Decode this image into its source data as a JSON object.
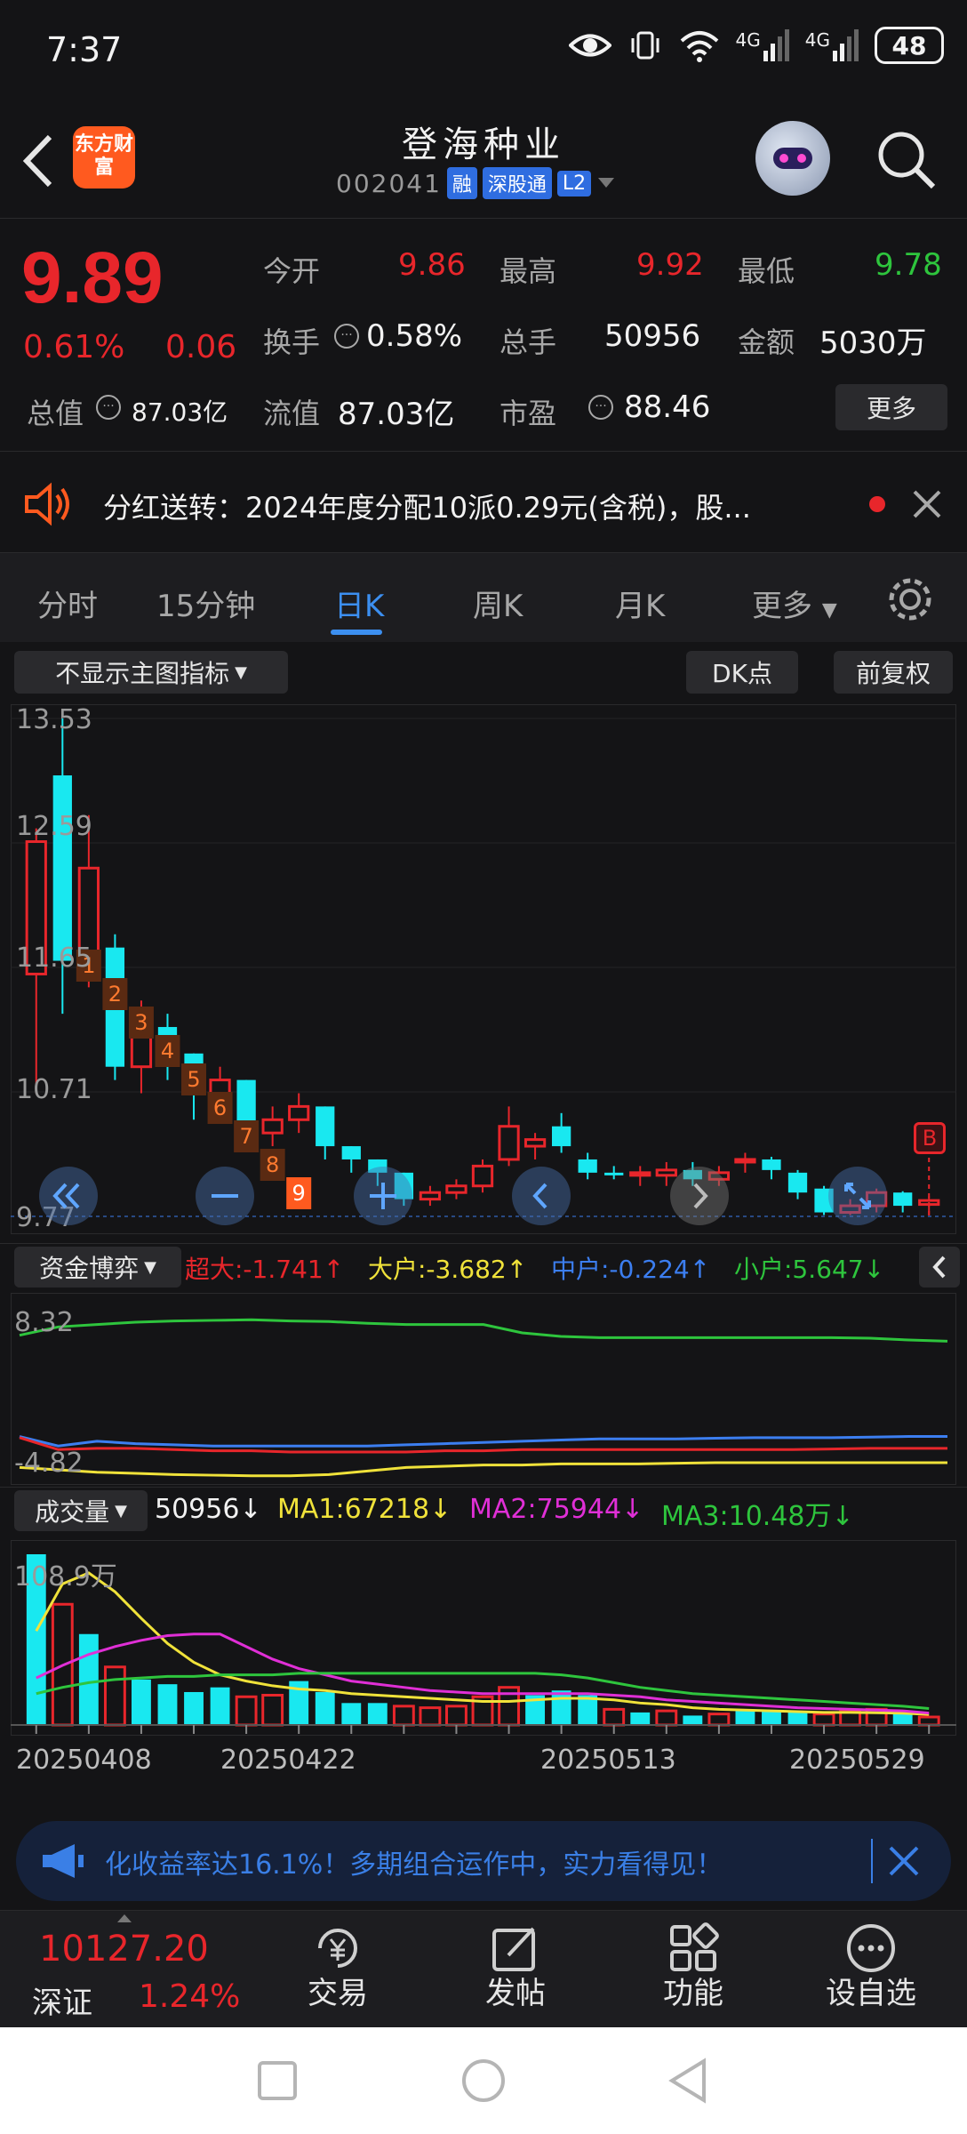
{
  "status_bar": {
    "time": "7:37",
    "battery": "48",
    "network1": "4G",
    "network2": "4G"
  },
  "header": {
    "stock_name": "登海种业",
    "stock_code": "002041",
    "tags": [
      "融",
      "深股通",
      "L2"
    ],
    "brand": "东方财富"
  },
  "quote": {
    "price": "9.89",
    "change_pct": "0.61%",
    "change": "0.06",
    "open_label": "今开",
    "open": "9.86",
    "high_label": "最高",
    "high": "9.92",
    "low_label": "最低",
    "low": "9.78",
    "turnover_label": "换手",
    "turnover": "0.58%",
    "volume_label": "总手",
    "volume": "50956",
    "amount_label": "金额",
    "amount": "5030万",
    "mktcap_label": "总值",
    "mktcap": "87.03亿",
    "float_label": "流值",
    "float_value": "87.03亿",
    "pe_label": "市盈",
    "pe": "88.46",
    "more_label": "更多"
  },
  "notice": {
    "text": "分红送转：2024年度分配10派0.29元(含税)，股..."
  },
  "tabs": [
    {
      "label": "分时"
    },
    {
      "label": "15分钟"
    },
    {
      "label": "日K"
    },
    {
      "label": "周K"
    },
    {
      "label": "月K"
    },
    {
      "label": "更多"
    }
  ],
  "chart_toolbar": {
    "indicator_select": "不显示主图指标",
    "dk_label": "DK点",
    "adjust_label": "前复权"
  },
  "kline": {
    "y_labels": [
      "13.53",
      "12.59",
      "11.65",
      "10.71",
      "9.77"
    ],
    "b_marker": "B",
    "counts": [
      "1",
      "2",
      "3",
      "4",
      "5",
      "6",
      "7",
      "8",
      "9"
    ]
  },
  "fund_flow": {
    "selector": "资金博弈",
    "super_large": "超大:-1.741↑",
    "large": "大户:-3.682↑",
    "medium": "中户:-0.224↑",
    "small": "小户:5.647↓",
    "y_top": "8.32",
    "y_bottom": "-4.82"
  },
  "volume": {
    "selector": "成交量",
    "value": "50956↓",
    "ma1": "MA1:67218↓",
    "ma2": "MA2:75944↓",
    "ma3": "MA3:10.48万↓",
    "y_top": "108.9万",
    "dates": [
      "20250408",
      "20250422",
      "20250513",
      "20250529"
    ]
  },
  "ad_banner": {
    "text": "化收益率达16.1%！多期组合运作中，实力看得见！"
  },
  "bottom_nav": {
    "index_value": "10127.20",
    "index_name": "深证",
    "index_pct": "1.24%",
    "items": [
      {
        "label": "交易"
      },
      {
        "label": "发帖"
      },
      {
        "label": "功能"
      },
      {
        "label": "设自选"
      }
    ]
  },
  "chart_data": [
    {
      "type": "candlestick",
      "title": "",
      "ylim": [
        9.77,
        13.53
      ],
      "candles": [
        {
          "o": 12.6,
          "c": 11.6,
          "h": 12.7,
          "l": 10.7,
          "dir": "up"
        },
        {
          "o": 13.1,
          "c": 11.7,
          "h": 13.53,
          "l": 11.3,
          "dir": "down"
        },
        {
          "o": 11.6,
          "c": 12.4,
          "h": 12.8,
          "l": 11.5,
          "dir": "up"
        },
        {
          "o": 11.8,
          "c": 10.9,
          "h": 11.9,
          "l": 10.8,
          "dir": "down"
        },
        {
          "o": 10.9,
          "c": 11.3,
          "h": 11.4,
          "l": 10.7,
          "dir": "up"
        },
        {
          "o": 11.2,
          "c": 10.9,
          "h": 11.3,
          "l": 10.8,
          "dir": "down"
        },
        {
          "o": 11.0,
          "c": 10.7,
          "h": 11.0,
          "l": 10.5,
          "dir": "down"
        },
        {
          "o": 10.7,
          "c": 10.8,
          "h": 10.9,
          "l": 10.6,
          "dir": "up"
        },
        {
          "o": 10.8,
          "c": 10.4,
          "h": 10.8,
          "l": 10.3,
          "dir": "down"
        },
        {
          "o": 10.4,
          "c": 10.5,
          "h": 10.6,
          "l": 10.3,
          "dir": "up"
        },
        {
          "o": 10.5,
          "c": 10.6,
          "h": 10.7,
          "l": 10.4,
          "dir": "up"
        },
        {
          "o": 10.6,
          "c": 10.3,
          "h": 10.6,
          "l": 10.2,
          "dir": "down"
        },
        {
          "o": 10.3,
          "c": 10.2,
          "h": 10.3,
          "l": 10.1,
          "dir": "down"
        },
        {
          "o": 10.2,
          "c": 10.1,
          "h": 10.2,
          "l": 10.0,
          "dir": "down"
        },
        {
          "o": 10.1,
          "c": 9.9,
          "h": 10.1,
          "l": 9.85,
          "dir": "down"
        },
        {
          "o": 9.9,
          "c": 9.95,
          "h": 10.0,
          "l": 9.85,
          "dir": "up"
        },
        {
          "o": 9.95,
          "c": 10.0,
          "h": 10.05,
          "l": 9.9,
          "dir": "up"
        },
        {
          "o": 10.0,
          "c": 10.15,
          "h": 10.2,
          "l": 9.95,
          "dir": "up"
        },
        {
          "o": 10.2,
          "c": 10.45,
          "h": 10.6,
          "l": 10.15,
          "dir": "up"
        },
        {
          "o": 10.3,
          "c": 10.35,
          "h": 10.4,
          "l": 10.2,
          "dir": "up"
        },
        {
          "o": 10.45,
          "c": 10.3,
          "h": 10.55,
          "l": 10.25,
          "dir": "down"
        },
        {
          "o": 10.2,
          "c": 10.1,
          "h": 10.25,
          "l": 10.05,
          "dir": "down"
        },
        {
          "o": 10.1,
          "c": 10.08,
          "h": 10.15,
          "l": 10.05,
          "dir": "down"
        },
        {
          "o": 10.08,
          "c": 10.1,
          "h": 10.15,
          "l": 10.0,
          "dir": "up"
        },
        {
          "o": 10.08,
          "c": 10.12,
          "h": 10.18,
          "l": 10.0,
          "dir": "up"
        },
        {
          "o": 10.12,
          "c": 10.05,
          "h": 10.18,
          "l": 10.0,
          "dir": "down"
        },
        {
          "o": 10.05,
          "c": 10.1,
          "h": 10.15,
          "l": 10.0,
          "dir": "up"
        },
        {
          "o": 10.18,
          "c": 10.2,
          "h": 10.25,
          "l": 10.1,
          "dir": "up"
        },
        {
          "o": 10.2,
          "c": 10.12,
          "h": 10.22,
          "l": 10.05,
          "dir": "down"
        },
        {
          "o": 10.1,
          "c": 9.95,
          "h": 10.12,
          "l": 9.9,
          "dir": "down"
        },
        {
          "o": 9.98,
          "c": 9.8,
          "h": 10.0,
          "l": 9.78,
          "dir": "down"
        },
        {
          "o": 9.8,
          "c": 9.85,
          "h": 9.9,
          "l": 9.78,
          "dir": "up"
        },
        {
          "o": 9.85,
          "c": 9.95,
          "h": 9.98,
          "l": 9.8,
          "dir": "up"
        },
        {
          "o": 9.95,
          "c": 9.85,
          "h": 9.96,
          "l": 9.8,
          "dir": "down"
        },
        {
          "o": 9.86,
          "c": 9.89,
          "h": 9.92,
          "l": 9.78,
          "dir": "up"
        }
      ]
    },
    {
      "type": "line",
      "title": "",
      "ylim": [
        -4.82,
        8.32
      ],
      "series": [
        {
          "color": "#2ec53d",
          "values": [
            7.0,
            7.7,
            7.9,
            8.1,
            8.2,
            8.25,
            8.3,
            8.2,
            8.15,
            8.0,
            7.9,
            7.9,
            7.9,
            7.2,
            6.9,
            6.8,
            6.8,
            6.8,
            6.8,
            6.8,
            6.8,
            6.8,
            6.75,
            6.6,
            6.5
          ]
        },
        {
          "color": "#3c7ef0",
          "values": [
            -1.5,
            -2.3,
            -1.9,
            -2.1,
            -2.2,
            -2.3,
            -2.3,
            -2.3,
            -2.3,
            -2.3,
            -2.2,
            -2.1,
            -2.0,
            -1.9,
            -1.8,
            -1.7,
            -1.7,
            -1.7,
            -1.65,
            -1.6,
            -1.6,
            -1.6,
            -1.55,
            -1.5,
            -1.5
          ]
        },
        {
          "color": "#e8262b",
          "values": [
            -1.6,
            -2.6,
            -2.5,
            -2.5,
            -2.6,
            -2.7,
            -2.7,
            -2.8,
            -2.8,
            -2.8,
            -2.8,
            -2.7,
            -2.7,
            -2.6,
            -2.6,
            -2.6,
            -2.6,
            -2.6,
            -2.6,
            -2.6,
            -2.6,
            -2.55,
            -2.5,
            -2.5,
            -2.5
          ]
        },
        {
          "color": "#f0e23a",
          "values": [
            -4.1,
            -4.3,
            -4.5,
            -4.6,
            -4.7,
            -4.75,
            -4.8,
            -4.8,
            -4.7,
            -4.4,
            -4.1,
            -4.0,
            -3.9,
            -3.9,
            -3.8,
            -3.8,
            -3.8,
            -3.75,
            -3.7,
            -3.7,
            -3.7,
            -3.7,
            -3.7,
            -3.7,
            -3.7
          ]
        }
      ]
    },
    {
      "type": "bar",
      "title": "",
      "ylim": [
        0,
        108.9
      ],
      "values": [
        108.9,
        77,
        58,
        37,
        29,
        26,
        21,
        24,
        18,
        19,
        28,
        21,
        14,
        14,
        12,
        11,
        12,
        18,
        24,
        19,
        22,
        19,
        10,
        8,
        9,
        6,
        7,
        10,
        9,
        8,
        7,
        9,
        10,
        8,
        5.1
      ],
      "dirs": [
        "down",
        "up",
        "down",
        "up",
        "down",
        "down",
        "down",
        "down",
        "up",
        "up",
        "down",
        "down",
        "down",
        "down",
        "up",
        "up",
        "up",
        "up",
        "up",
        "down",
        "down",
        "down",
        "up",
        "down",
        "up",
        "down",
        "up",
        "down",
        "down",
        "down",
        "up",
        "up",
        "up",
        "down",
        "up"
      ],
      "ma_series": [
        {
          "name": "MA1",
          "color": "#f0e23a",
          "values": [
            60,
            90,
            97,
            85,
            68,
            52,
            40,
            32,
            28,
            25,
            23,
            22,
            20,
            19,
            18,
            17,
            16,
            15,
            15,
            16,
            17,
            17,
            16,
            14,
            13,
            11,
            10,
            9.5,
            9,
            8.5,
            8,
            8,
            7.8,
            7.5,
            6.7
          ]
        },
        {
          "name": "MA2",
          "color": "#e02fd6",
          "values": [
            30,
            38,
            45,
            50,
            54,
            57,
            58,
            58,
            50,
            42,
            36,
            32,
            28,
            26,
            24,
            22,
            21,
            20,
            20,
            20,
            20,
            20,
            19,
            18,
            16,
            15,
            14,
            13,
            12,
            11,
            10.5,
            10,
            9.5,
            9,
            7.6
          ]
        },
        {
          "name": "MA3",
          "color": "#2ec53d",
          "values": [
            20,
            24,
            27,
            29,
            30,
            31,
            31,
            32,
            32,
            32,
            33,
            33,
            33,
            33,
            33,
            33,
            33,
            33,
            33,
            33,
            32,
            30,
            27,
            24,
            22,
            20,
            19,
            18,
            17,
            16,
            15,
            14,
            13,
            12,
            10.5
          ]
        }
      ]
    }
  ]
}
